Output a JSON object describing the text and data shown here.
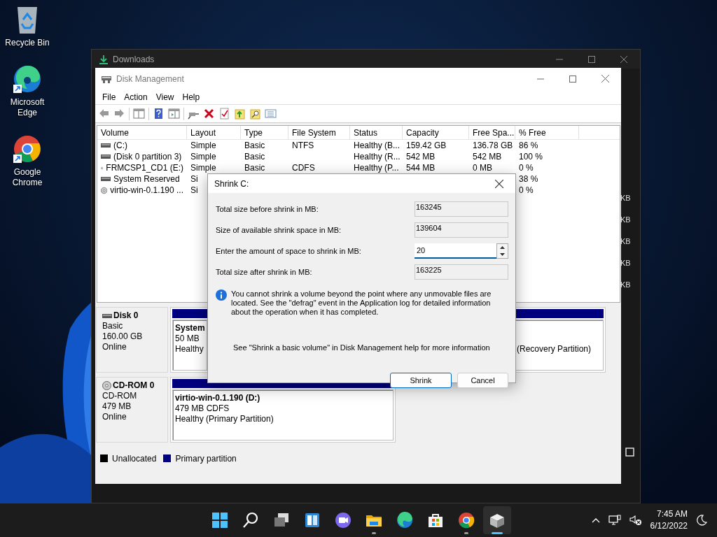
{
  "desktop_icons": [
    {
      "kind": "recycle",
      "label": "Recycle Bin",
      "shortcut": false
    },
    {
      "kind": "edge",
      "label": "Microsoft Edge",
      "shortcut": true
    },
    {
      "kind": "chrome",
      "label": "Google Chrome",
      "shortcut": true
    }
  ],
  "explorer": {
    "title": "Downloads",
    "size_cells": [
      "KB",
      "KB",
      "KB",
      "KB",
      "KB"
    ]
  },
  "disk_management": {
    "title": "Disk Management",
    "menu": [
      "File",
      "Action",
      "View",
      "Help"
    ],
    "table": {
      "columns": [
        "Volume",
        "Layout",
        "Type",
        "File System",
        "Status",
        "Capacity",
        "Free Spa...",
        "% Free"
      ],
      "rows": [
        {
          "kind": "drive",
          "cells": [
            "(C:)",
            "Simple",
            "Basic",
            "NTFS",
            "Healthy (B...",
            "159.42 GB",
            "136.78 GB",
            "86 %"
          ]
        },
        {
          "kind": "drive",
          "cells": [
            "(Disk 0 partition 3)",
            "Simple",
            "Basic",
            null,
            "Healthy (R...",
            "542 MB",
            "542 MB",
            "100 %"
          ]
        },
        {
          "kind": "cd",
          "cells": [
            "FRMCSP1_CD1 (E:)",
            "Simple",
            "Basic",
            "CDFS",
            "Healthy (P...",
            "544 MB",
            "0 MB",
            "0 %"
          ]
        },
        {
          "kind": "drive",
          "cells": [
            "System Reserved",
            "Si",
            null,
            null,
            null,
            null,
            null,
            "38 %"
          ]
        },
        {
          "kind": "cd",
          "cells": [
            "virtio-win-0.1.190 ...",
            "Si",
            null,
            null,
            null,
            null,
            null,
            "0 %"
          ]
        }
      ]
    },
    "disks": [
      {
        "kind": "disk",
        "name": "Disk 0",
        "type": "Basic",
        "size": "160.00 GB",
        "status": "Online",
        "partitions": [
          {
            "name": "System",
            "size": "50 MB",
            "health": "Healthy"
          },
          {
            "health": "(Recovery Partition)"
          }
        ]
      },
      {
        "kind": "cdrom",
        "name": "CD-ROM 0",
        "type": "CD-ROM",
        "size": "479 MB",
        "status": "Online",
        "partitions": [
          {
            "name": "virtio-win-0.1.190  (D:)",
            "size": "479 MB CDFS",
            "health": "Healthy (Primary Partition)"
          }
        ]
      }
    ],
    "legend": [
      {
        "label": "Unallocated",
        "color": "#000000"
      },
      {
        "label": "Primary partition",
        "color": "#000080"
      }
    ]
  },
  "dialog": {
    "title": "Shrink C:",
    "fields": [
      {
        "kind": "readonly",
        "label": "Total size before shrink in MB:",
        "value": "163245"
      },
      {
        "kind": "readonly",
        "label": "Size of available shrink space in MB:",
        "value": "139604"
      },
      {
        "kind": "spin",
        "label": "Enter the amount of space to shrink in MB:",
        "value": "20"
      },
      {
        "kind": "readonly",
        "label": "Total size after shrink in MB:",
        "value": "163225"
      }
    ],
    "info": "You cannot shrink a volume beyond the point where any unmovable files are located. See the \"defrag\" event in the Application log for detailed information about the operation when it has completed.",
    "help": "See \"Shrink a basic volume\" in Disk Management help for more information",
    "buttons": [
      {
        "label": "Shrink",
        "default": true
      },
      {
        "label": "Cancel",
        "default": false
      }
    ]
  },
  "taskbar": {
    "apps": [
      {
        "kind": "start",
        "running": false,
        "selected": false
      },
      {
        "kind": "search",
        "running": false,
        "selected": false
      },
      {
        "kind": "taskview",
        "running": false,
        "selected": false
      },
      {
        "kind": "widgets",
        "running": false,
        "selected": false
      },
      {
        "kind": "chat",
        "running": false,
        "selected": false
      },
      {
        "kind": "explorer",
        "running": true,
        "selected": false
      },
      {
        "kind": "edge",
        "running": false,
        "selected": false
      },
      {
        "kind": "store",
        "running": false,
        "selected": false
      },
      {
        "kind": "chrome",
        "running": true,
        "selected": false
      },
      {
        "kind": "diskmgmt",
        "running": true,
        "selected": true
      }
    ],
    "clock": {
      "time": "7:45 AM",
      "date": "6/12/2022"
    }
  }
}
